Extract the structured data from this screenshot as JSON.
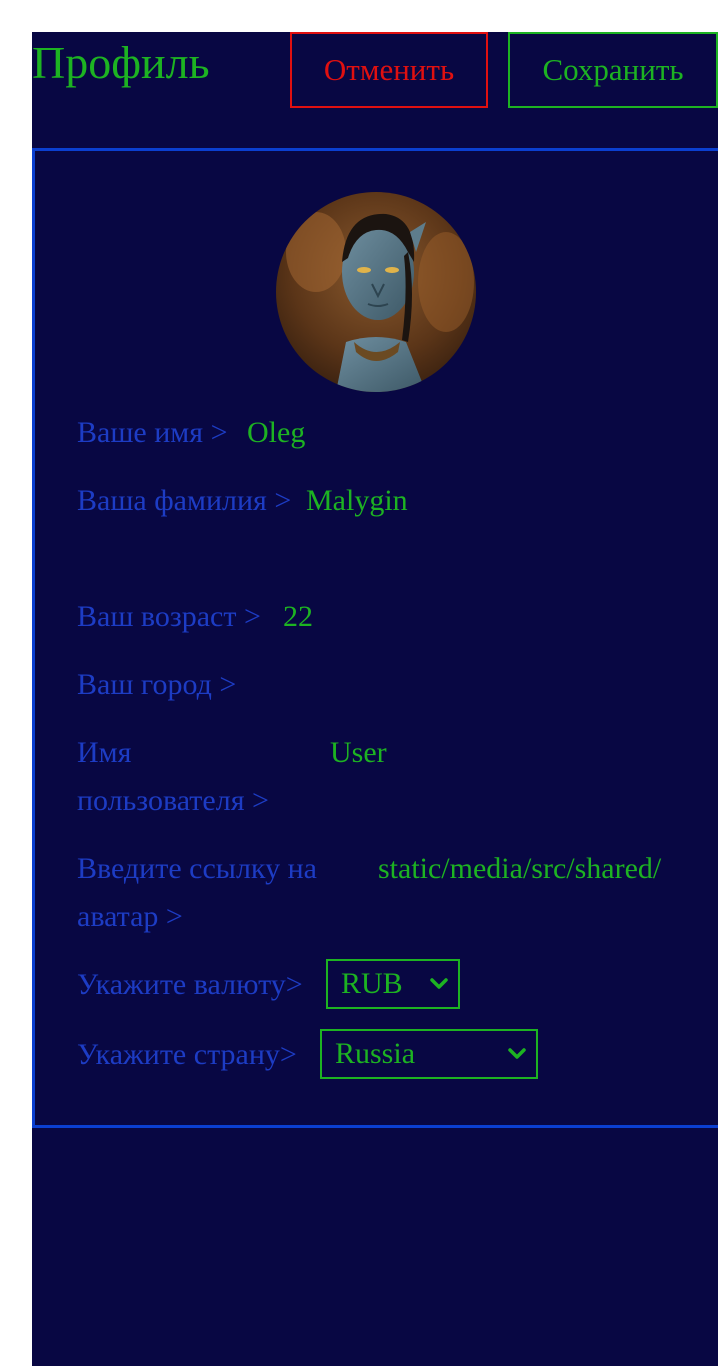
{
  "header": {
    "title": "Профиль",
    "cancel_label": "Отменить",
    "save_label": "Сохранить"
  },
  "profile": {
    "first_name_label": "Ваше имя >",
    "first_name_value": "Oleg",
    "last_name_label": "Ваша фамилия >",
    "last_name_value": "Malygin",
    "age_label": "Ваш возраст >",
    "age_value": "22",
    "city_label": "Ваш город >",
    "city_value": "",
    "username_label": "Имя пользователя >",
    "username_value": "User",
    "avatar_link_label": "Введите ссылку на аватар >",
    "avatar_link_value": "static/media/src/shared/",
    "currency_label": "Укажите валюту>",
    "currency_value": "RUB",
    "country_label": "Укажите страну>",
    "country_value": "Russia"
  },
  "colors": {
    "background": "#080743",
    "accent_green": "#1db322",
    "label_blue": "#1d3cc4",
    "border_blue": "#0b3fd0",
    "danger_red": "#e01010"
  },
  "icons": {
    "select_arrow": "chevron-down-icon"
  }
}
